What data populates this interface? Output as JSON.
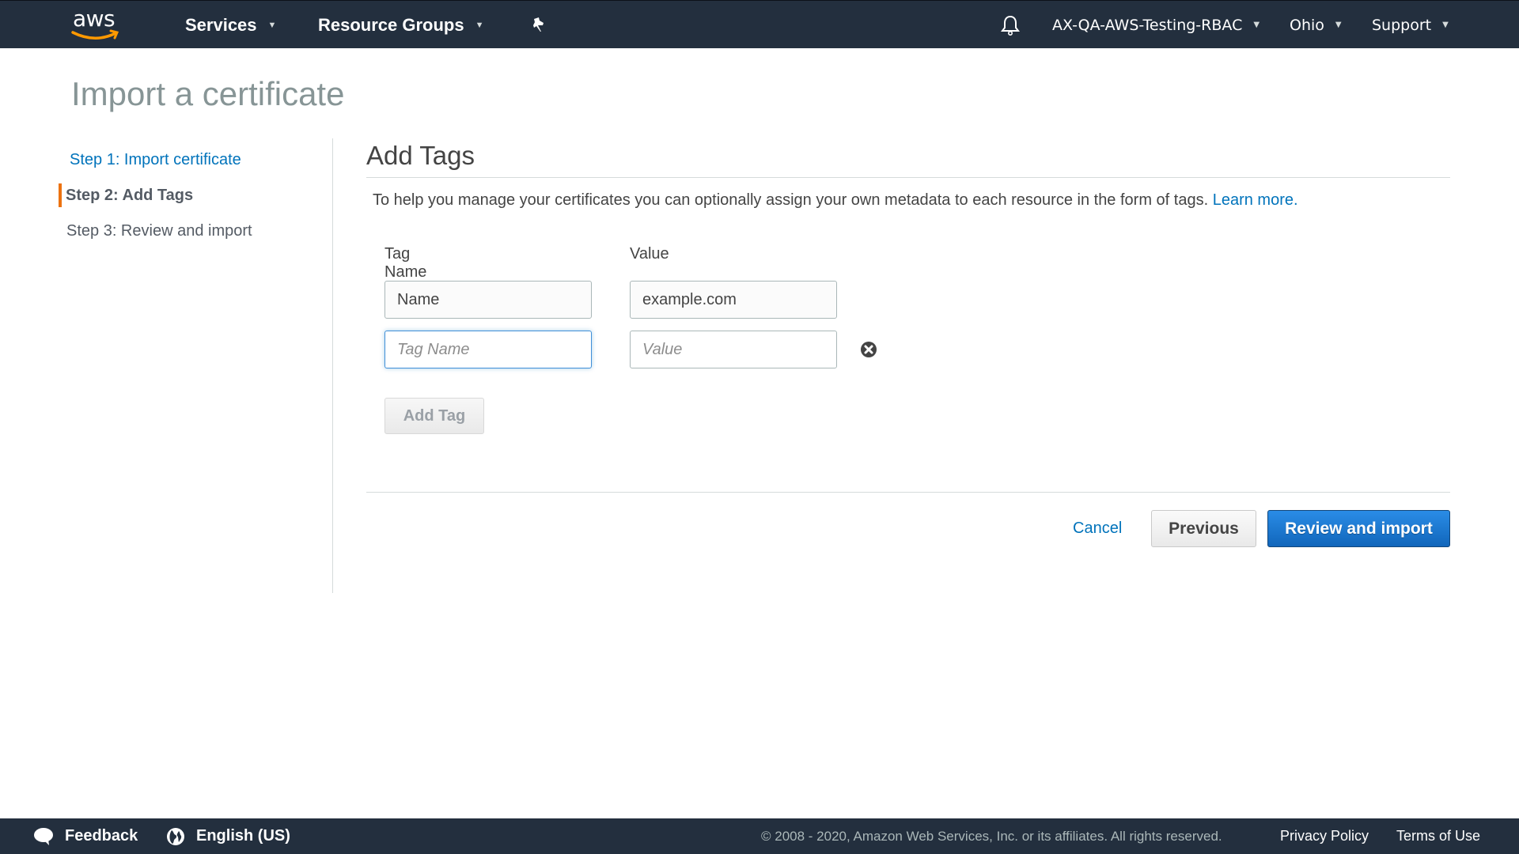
{
  "topnav": {
    "logo_text": "aws",
    "services_label": "Services",
    "resource_groups_label": "Resource Groups",
    "account_label": "AX-QA-AWS-Testing-RBAC",
    "region_label": "Ohio",
    "support_label": "Support",
    "icons": {
      "pin": "pushpin-icon",
      "bell": "bell-icon",
      "caret": "caret-down-icon"
    }
  },
  "page": {
    "title": "Import a certificate"
  },
  "steps": [
    {
      "label": "Step 1: Import certificate",
      "state": "link"
    },
    {
      "label": "Step 2: Add Tags",
      "state": "active"
    },
    {
      "label": "Step 3: Review and import",
      "state": "future"
    }
  ],
  "main": {
    "section_title": "Add Tags",
    "description": "To help you manage your certificates you can optionally assign your own metadata to each resource in the form of tags.",
    "learn_more": "Learn more.",
    "columns": {
      "tag_name": "Tag Name",
      "value": "Value"
    },
    "rows": [
      {
        "tag_name": "Name",
        "value": "example.com"
      },
      {
        "tag_name_placeholder": "Tag Name",
        "value_placeholder": "Value"
      }
    ],
    "add_tag_label": "Add Tag",
    "cancel_label": "Cancel",
    "previous_label": "Previous",
    "primary_label": "Review and import"
  },
  "footer": {
    "feedback_label": "Feedback",
    "language_label": "English (US)",
    "copyright": "© 2008 - 2020, Amazon Web Services, Inc. or its affiliates. All rights reserved.",
    "privacy_label": "Privacy Policy",
    "terms_label": "Terms of Use"
  },
  "colors": {
    "nav_bg": "#232f3e",
    "accent_orange": "#ec7211",
    "link_blue": "#0073bb",
    "primary_blue": "#1a73cc"
  }
}
